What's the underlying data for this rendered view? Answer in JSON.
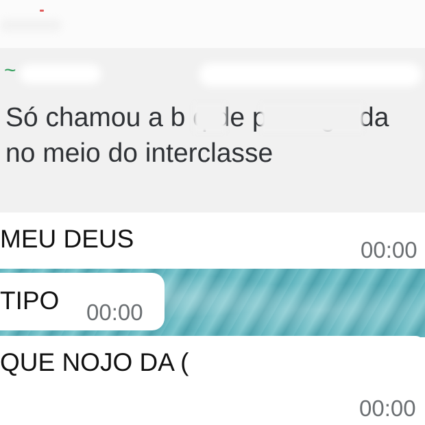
{
  "quoted_message": {
    "sender_prefix": "~",
    "text": "Só chamou a b q de preta gorda no meio do interclasse"
  },
  "messages": [
    {
      "text": "MEU DEUS",
      "time": "00:00"
    },
    {
      "text": "TIPO",
      "time": "00:00"
    },
    {
      "text": "QUE NOJO DA (",
      "time": "00:00"
    }
  ],
  "colors": {
    "sender_green": "#2e9d58",
    "quoted_bg": "#f1f1f1",
    "wallpaper": "#5fb3bd"
  }
}
